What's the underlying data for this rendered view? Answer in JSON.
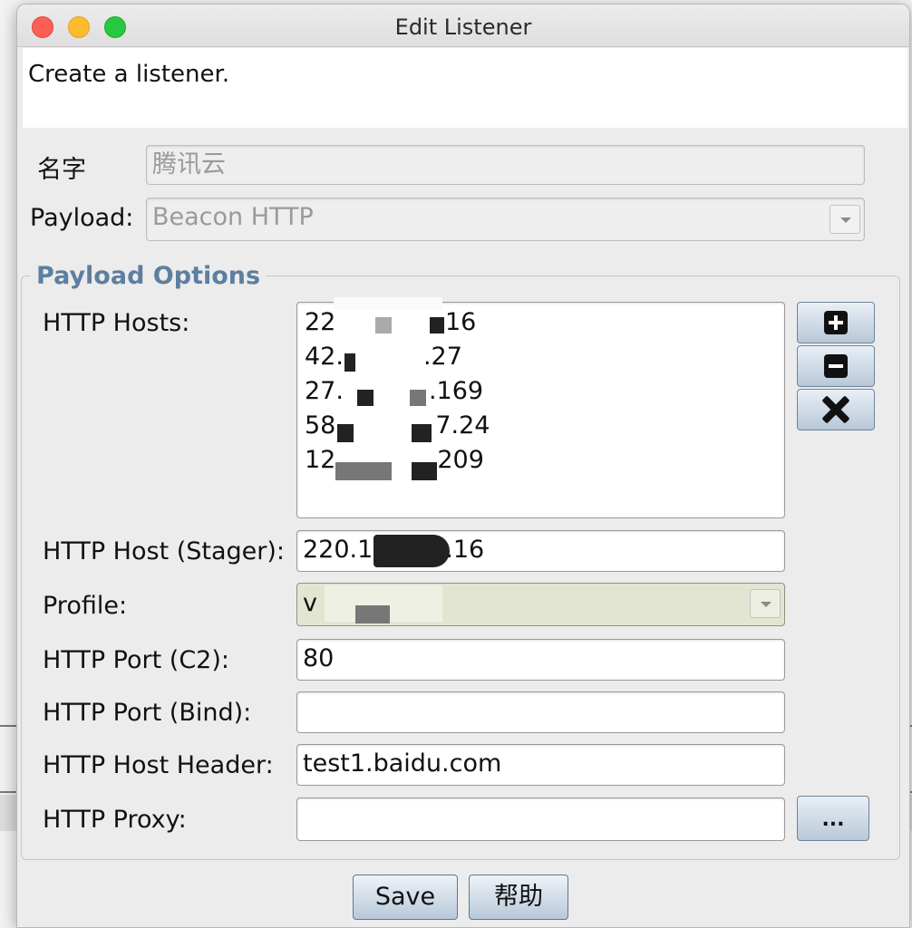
{
  "window": {
    "title": "Edit Listener"
  },
  "description": "Create a listener.",
  "form": {
    "name_label": "名字",
    "name_value": "腾讯云",
    "payload_label": "Payload:",
    "payload_value": "Beacon HTTP"
  },
  "options": {
    "legend": "Payload Options",
    "http_hosts_label": "HTTP Hosts:",
    "http_hosts": [
      {
        "prefix": "22",
        "suffix": ".16"
      },
      {
        "prefix": "42.",
        "suffix": ".27"
      },
      {
        "prefix": "27.",
        "suffix": ".169"
      },
      {
        "prefix": "58",
        "suffix": "7.24"
      },
      {
        "prefix": "12",
        "suffix": "209"
      }
    ],
    "host_tools": {
      "add": "add-host",
      "remove": "remove-host",
      "clear": "clear-hosts"
    },
    "stager_label": "HTTP Host (Stager):",
    "stager_prefix": "220.1",
    "stager_suffix": ".16",
    "profile_label": "Profile:",
    "profile_value": "v",
    "port_c2_label": "HTTP Port (C2):",
    "port_c2_value": "80",
    "port_bind_label": "HTTP Port (Bind):",
    "port_bind_value": "",
    "host_header_label": "HTTP Host Header:",
    "host_header_value": "test1.baidu.com",
    "proxy_label": "HTTP Proxy:",
    "proxy_value": "",
    "proxy_button": "..."
  },
  "buttons": {
    "save": "Save",
    "help": "帮助"
  }
}
